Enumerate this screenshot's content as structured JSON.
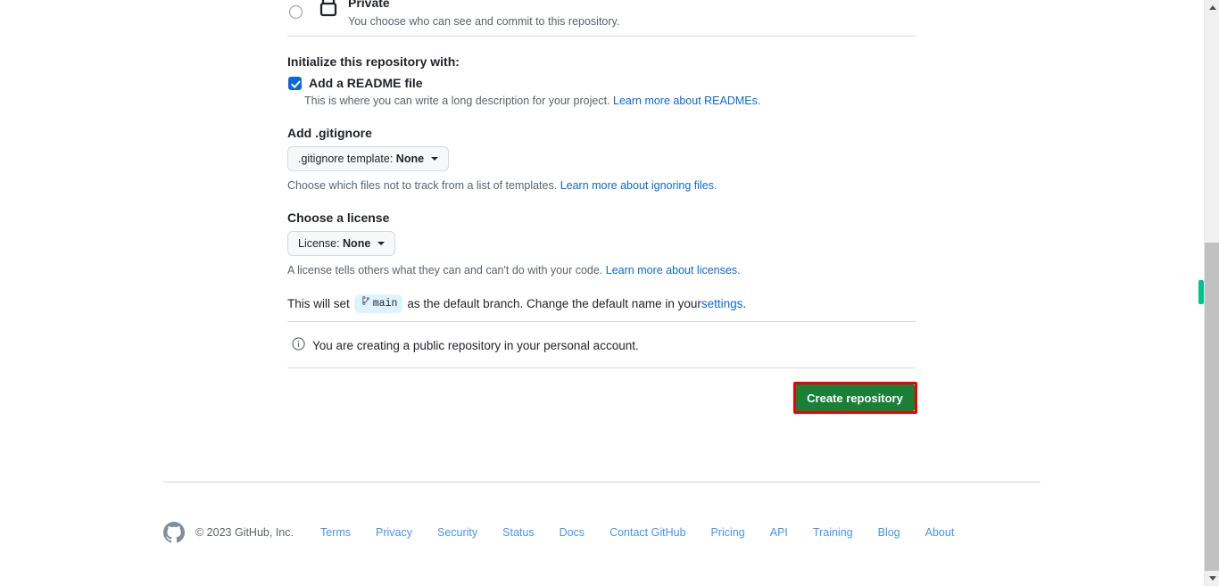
{
  "visibility": {
    "option_title": "Private",
    "option_desc": "You choose who can see and commit to this repository.",
    "icon": "lock-icon",
    "selected": false
  },
  "initialize": {
    "heading": "Initialize this repository with:",
    "readme": {
      "label": "Add a README file",
      "checked": true,
      "desc_prefix": "This is where you can write a long description for your project. ",
      "link_text": "Learn more about READMEs."
    }
  },
  "gitignore": {
    "heading": "Add .gitignore",
    "button_prefix": ".gitignore template: ",
    "button_value": "None",
    "help_prefix": "Choose which files not to track from a list of templates. ",
    "help_link": "Learn more about ignoring files."
  },
  "license": {
    "heading": "Choose a license",
    "button_prefix": "License: ",
    "button_value": "None",
    "help_prefix": "A license tells others what they can and can't do with your code. ",
    "help_link": "Learn more about licenses."
  },
  "branch": {
    "text_before": "This will set",
    "badge": "main",
    "badge_icon": "git-branch-icon",
    "text_after": "as the default branch. Change the default name in your ",
    "link_text": "settings",
    "trailing": "."
  },
  "notice": {
    "icon": "info-icon",
    "text": "You are creating a public repository in your personal account."
  },
  "actions": {
    "create_label": "Create repository",
    "create_color": "#1a7f37",
    "annotation_color": "#ee0000"
  },
  "footer": {
    "logo": "github-mark-icon",
    "copyright": "© 2023 GitHub, Inc.",
    "links": [
      {
        "label": "Terms"
      },
      {
        "label": "Privacy"
      },
      {
        "label": "Security"
      },
      {
        "label": "Status"
      },
      {
        "label": "Docs"
      },
      {
        "label": "Contact GitHub"
      },
      {
        "label": "Pricing"
      },
      {
        "label": "API"
      },
      {
        "label": "Training"
      },
      {
        "label": "Blog"
      },
      {
        "label": "About"
      }
    ]
  },
  "scrollbar": {
    "up_icon": "chevron-up-icon",
    "down_icon": "chevron-down-icon",
    "marker_color": "#00c48c"
  }
}
